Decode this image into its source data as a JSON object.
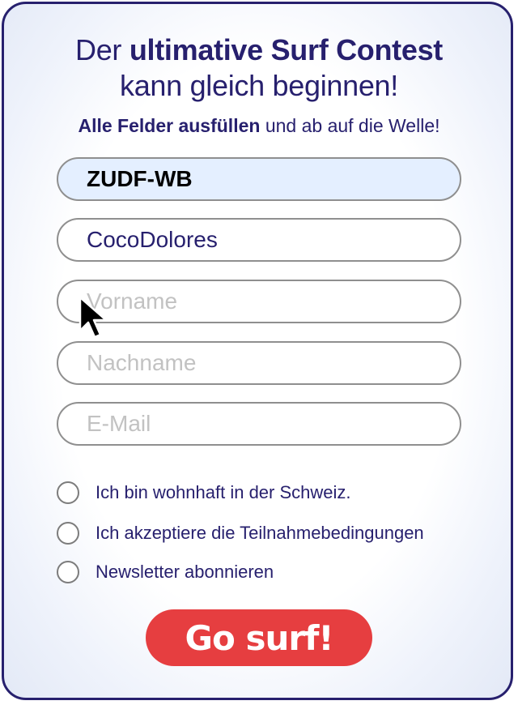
{
  "header": {
    "line1_pre": "Der ",
    "line1_bold": "ultimative Surf Contest",
    "line2": "kann gleich beginnen!",
    "sub_bold": "Alle Felder ausfüllen",
    "sub_rest": " und ab auf die Welle!"
  },
  "form": {
    "code": {
      "value": "ZUDF-WB",
      "placeholder": ""
    },
    "username": {
      "value": "CocoDolores",
      "placeholder": ""
    },
    "firstname": {
      "value": "",
      "placeholder": "Vorname"
    },
    "lastname": {
      "value": "",
      "placeholder": "Nachname"
    },
    "email": {
      "value": "",
      "placeholder": "E-Mail"
    }
  },
  "checkboxes": [
    {
      "label": "Ich bin wohnhaft in der Schweiz.",
      "checked": false
    },
    {
      "label": "Ich akzeptiere die Teilnahmebedingungen",
      "checked": false
    },
    {
      "label": "Newsletter abonnieren",
      "checked": false
    }
  ],
  "submit": {
    "label": "Go surf!"
  },
  "colors": {
    "text_primary": "#27206e",
    "accent_button": "#e63e40",
    "highlight_field": "#e4efff",
    "border": "#8f8f8f"
  },
  "icons": {
    "cursor": "mouse-pointer-icon"
  }
}
